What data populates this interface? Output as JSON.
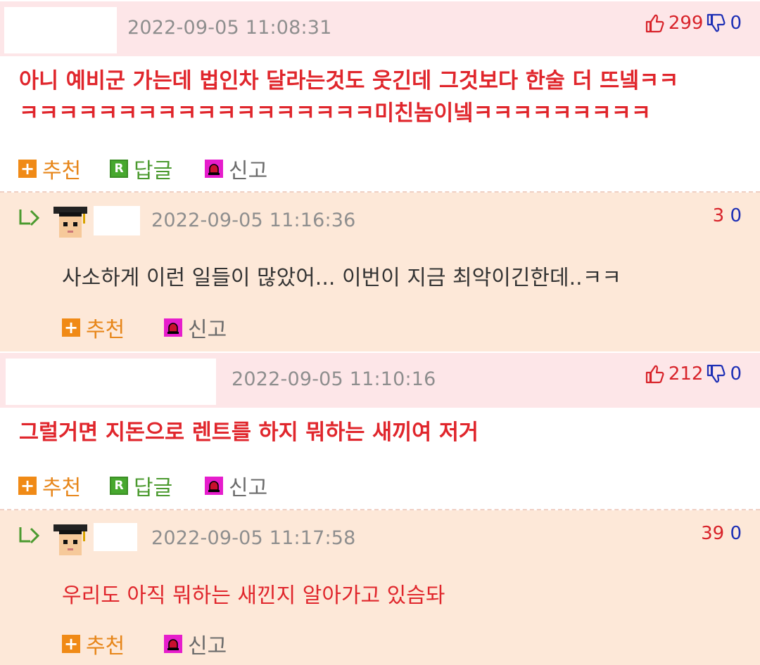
{
  "comments": [
    {
      "timestamp": "2022-09-05 11:08:31",
      "up_count": "299",
      "down_count": "0",
      "body_line1": "아니 예비군 가는데 법인차 달라는것도 웃긴데 그것보다 한술 더 뜨넼ㅋㅋ",
      "body_line2": "ㅋㅋㅋㅋㅋㅋㅋㅋㅋㅋㅋㅋㅋㅋㅋㅋㅋㅋ미친놈이넼ㅋㅋㅋㅋㅋㅋㅋㅋㅋ",
      "actions": {
        "recommend": "추천",
        "reply": "답글",
        "report": "신고"
      },
      "reply": {
        "timestamp": "2022-09-05 11:16:36",
        "up_count": "3",
        "down_count": "0",
        "text": "사소하게 이런 일들이 많았어... 이번이 지금 최악이긴한데..ㅋㅋ",
        "actions": {
          "recommend": "추천",
          "report": "신고"
        }
      }
    },
    {
      "timestamp": "2022-09-05 11:10:16",
      "up_count": "212",
      "down_count": "0",
      "body_line1": "그럴거면 지돈으로 렌트를 하지 뭐하는 새끼여 저거",
      "actions": {
        "recommend": "추천",
        "reply": "답글",
        "report": "신고"
      },
      "reply": {
        "timestamp": "2022-09-05 11:17:58",
        "up_count": "39",
        "down_count": "0",
        "text": "우리도 아직 뭐하는 새낀지 알아가고 있슴돠",
        "actions": {
          "recommend": "추천",
          "report": "신고"
        }
      }
    }
  ],
  "colors": {
    "header_bg": "#fde6e8",
    "reply_bg": "#fde8d8",
    "best_text": "#e0262c",
    "upvote": "#d8232a",
    "downvote": "#1d2fb5",
    "recommend": "#e7861a",
    "reply_label": "#4b9a2f"
  },
  "icons": [
    "thumbs-up-icon",
    "thumbs-down-icon",
    "plus-icon",
    "reply-r-icon",
    "siren-icon",
    "reply-arrow-icon",
    "graduate-avatar-icon"
  ]
}
